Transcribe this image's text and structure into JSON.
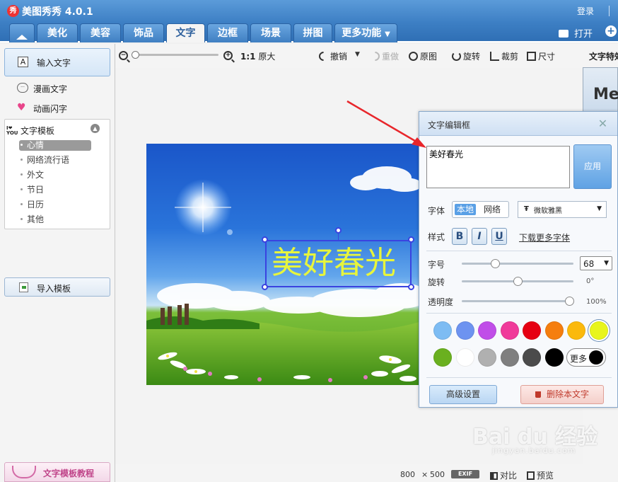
{
  "app": {
    "title": "美图秀秀 4.0.1",
    "logo_char": "秀",
    "login": "登录"
  },
  "tabs": [
    {
      "label": "美化"
    },
    {
      "label": "美容"
    },
    {
      "label": "饰品"
    },
    {
      "label": "文字",
      "active": true
    },
    {
      "label": "边框"
    },
    {
      "label": "场景"
    },
    {
      "label": "拼图"
    },
    {
      "label": "更多功能"
    }
  ],
  "topright": {
    "open_label": "打开"
  },
  "sidebar": {
    "input_text": "输入文字",
    "comic_text": "漫画文字",
    "animated_text": "动画闪字",
    "template_heading": "文字模板",
    "template_icon_text": "I❤ YOU",
    "template_items": [
      "心情",
      "网络流行语",
      "外文",
      "节日",
      "日历",
      "其他"
    ],
    "import_template": "导入模板",
    "tutorial": "文字模板教程"
  },
  "toolbar": {
    "zoom_original_icon_text": "1:1",
    "zoom_original": "原大",
    "undo": "撤销",
    "redo": "重做",
    "original": "原图",
    "rotate": "旋转",
    "crop": "裁剪",
    "resize": "尺寸"
  },
  "right_strip": {
    "title": "文字特效",
    "thumb_text": "Me"
  },
  "canvas": {
    "overlay_text": "美好春光",
    "overlay_color": "#e7f53c"
  },
  "dialog": {
    "title": "文字编辑框",
    "text_value": "美好春光",
    "apply": "应用",
    "font_label": "字体",
    "font_local": "本地",
    "font_web": "网络",
    "font_name": "微软雅黑",
    "style_label": "样式",
    "bold": "B",
    "italic": "I",
    "underline": "U",
    "more_fonts": "下载更多字体",
    "size_label": "字号",
    "size_value": "68",
    "size_level": 0.3,
    "rotate_label": "旋转",
    "rotate_value": "0°",
    "rotate_level": 0.5,
    "opacity_label": "透明度",
    "opacity_value": "100%",
    "opacity_level": 1.0,
    "colors_row1": [
      "#7dbcf3",
      "#6d93f0",
      "#c04ee8",
      "#f03a9a",
      "#e60012",
      "#f57e0e",
      "#fbb90c",
      "#e8f51c"
    ],
    "colors_row2": [
      "#6ab01f",
      "#ffffff",
      "#b0b0b0",
      "#7f7f7f",
      "#4b4b4b",
      "#000000"
    ],
    "selected_color": "#e8f51c",
    "more_colors": "更多",
    "advanced": "高级设置",
    "delete_text": "删除本文字"
  },
  "status": {
    "width": "800",
    "times": "×",
    "height": "500",
    "exif": "EXIF",
    "compare": "对比",
    "preview": "预览"
  },
  "watermark": {
    "brand": "Bai du 经验",
    "url": "jingyan.baidu.com"
  }
}
